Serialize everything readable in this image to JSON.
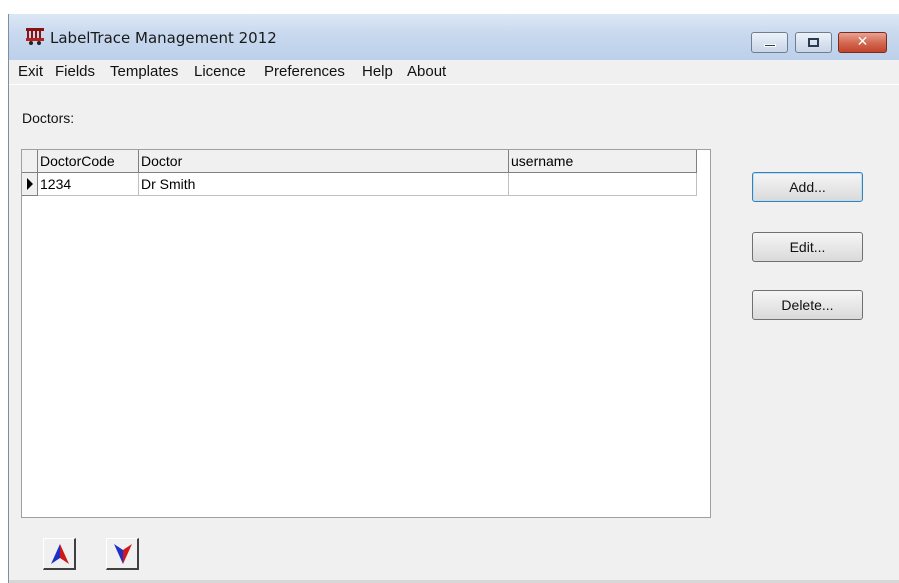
{
  "window": {
    "title": "LabelTrace Management 2012",
    "close_glyph": "✕",
    "icons": {
      "app": "labeltrace-app-icon",
      "minimize": "minimize-icon",
      "maximize": "maximize-icon",
      "close": "close-icon"
    }
  },
  "menu": [
    "Exit",
    "Fields",
    "Templates",
    "Licence",
    "Preferences",
    "Help",
    "About"
  ],
  "main": {
    "section_label": "Doctors:",
    "grid": {
      "columns": [
        "DoctorCode",
        "Doctor",
        "username"
      ],
      "rows": [
        {
          "code": "1234",
          "doctor": "Dr Smith",
          "username": ""
        }
      ],
      "current_row_indicator": "row-pointer-icon"
    },
    "buttons": {
      "add": "Add...",
      "edit": "Edit...",
      "delete": "Delete..."
    },
    "nav": {
      "up_icon": "arrow-up-icon",
      "down_icon": "arrow-down-icon"
    }
  },
  "colors": {
    "arrow_blue": "#1f2fc8",
    "arrow_red": "#d01818",
    "close_red": "#c2442b"
  }
}
